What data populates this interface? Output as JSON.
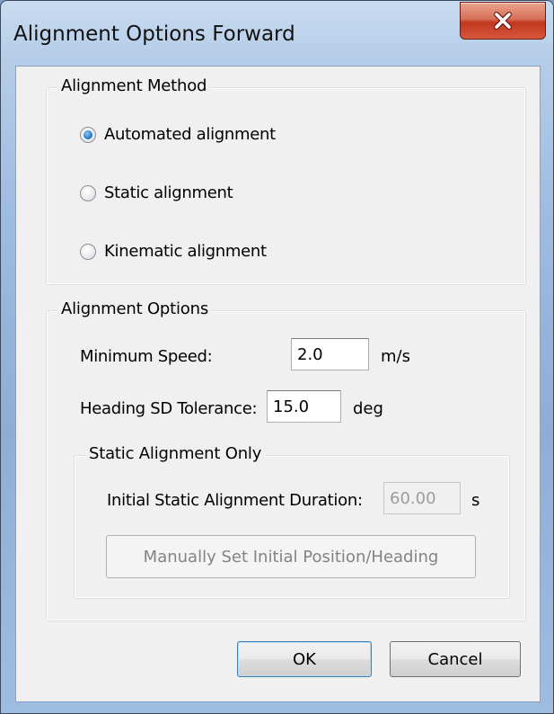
{
  "window": {
    "title": "Alignment Options Forward",
    "close_icon": "close-x-icon"
  },
  "alignment_method": {
    "legend": "Alignment Method",
    "options": [
      {
        "label": "Automated alignment",
        "checked": true
      },
      {
        "label": "Static alignment",
        "checked": false
      },
      {
        "label": "Kinematic alignment",
        "checked": false
      }
    ]
  },
  "alignment_options": {
    "legend": "Alignment Options",
    "min_speed": {
      "label": "Minimum Speed:",
      "value": "2.0",
      "unit": "m/s"
    },
    "heading_sd": {
      "label": "Heading SD Tolerance:",
      "value": "15.0",
      "unit": "deg"
    },
    "static_only": {
      "legend": "Static Alignment Only",
      "duration": {
        "label": "Initial Static Alignment Duration:",
        "value": "60.00",
        "unit": "s"
      },
      "manual_button": "Manually Set Initial Position/Heading"
    }
  },
  "buttons": {
    "ok": "OK",
    "cancel": "Cancel"
  }
}
